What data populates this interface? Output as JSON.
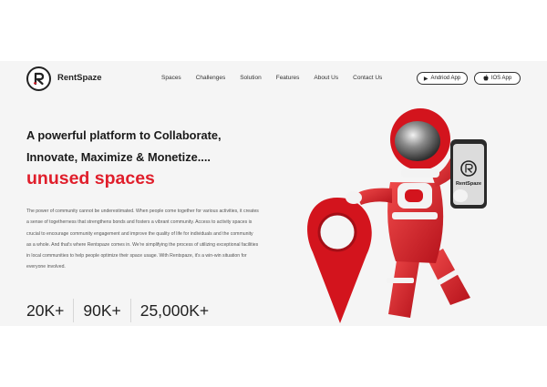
{
  "brand": {
    "name": "RentSpaze",
    "logo_icon": "rentspaze-logo-icon"
  },
  "nav": {
    "items": [
      "Spaces",
      "Challenges",
      "Solution",
      "Features",
      "About Us",
      "Contact Us"
    ]
  },
  "apps": {
    "android": {
      "label": "Andriod App",
      "icon": "play-icon"
    },
    "ios": {
      "label": "IOS App",
      "icon": "apple-icon"
    }
  },
  "hero": {
    "line1": "A powerful platform to Collaborate,",
    "line2": "Innovate, Maximize & Monetize....",
    "accent": "unused spaces",
    "paragraph": "The power of community cannot be underestimated. When people come together for various activities, it creates a sense of togetherness that strengthens bonds and fosters a vibrant community. Access to activity spaces is crucial to encourage community engagement and improve the quality of life for individuals and the community as a whole. And that's where Rentspaze comes in. We're simplifying the process of utilizing exceptional facilities in local communities to help people optimize their space usage. With Rentspaze, it's a win-win situation for everyone involved.",
    "accent_color": "#e01e2b"
  },
  "stats": [
    "20K+",
    "90K+",
    "25,000K+"
  ],
  "phone": {
    "brand": "RentSpaze"
  }
}
